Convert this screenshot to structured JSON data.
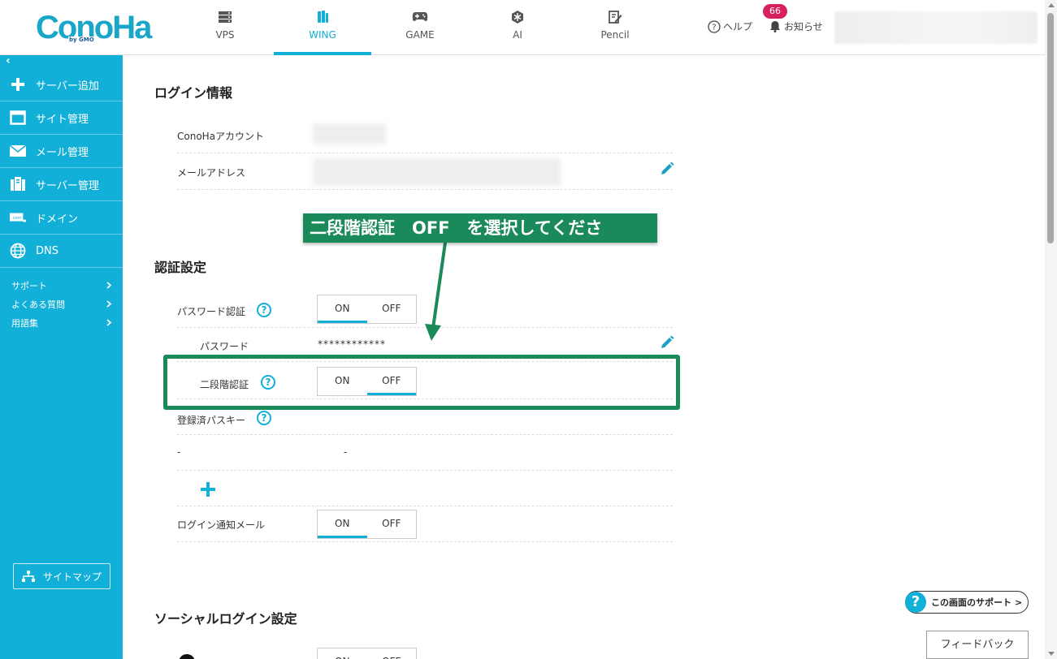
{
  "brand": {
    "logo": "ConoHa",
    "logo_sub": "by GMO",
    "accent": "#12b0d8",
    "annotation_color": "#1b8a5a"
  },
  "topnav": [
    {
      "label": "VPS",
      "icon": "server-icon",
      "active": false
    },
    {
      "label": "WING",
      "icon": "wing-icon",
      "active": true
    },
    {
      "label": "GAME",
      "icon": "gamepad-icon",
      "active": false
    },
    {
      "label": "AI",
      "icon": "ai-icon",
      "active": false
    },
    {
      "label": "Pencil",
      "icon": "pencil-icon",
      "active": false
    }
  ],
  "header": {
    "help": "ヘルプ",
    "notice": "お知らせ",
    "notice_count": "66"
  },
  "sidebar": {
    "collapse": "‹",
    "items": [
      {
        "label": "サーバー追加",
        "icon": "plus-icon"
      },
      {
        "label": "サイト管理",
        "icon": "window-icon"
      },
      {
        "label": "メール管理",
        "icon": "mail-icon"
      },
      {
        "label": "サーバー管理",
        "icon": "server-icon"
      },
      {
        "label": "ドメイン",
        "icon": "domain-icon"
      },
      {
        "label": "DNS",
        "icon": "globe-icon"
      }
    ],
    "subs": [
      {
        "label": "サポート"
      },
      {
        "label": "よくある質問"
      },
      {
        "label": "用語集"
      }
    ],
    "sitemap": "サイトマップ"
  },
  "login_info": {
    "title": "ログイン情報",
    "account_label": "ConoHaアカウント",
    "email_label": "メールアドレス"
  },
  "auth": {
    "title": "認証設定",
    "password_auth_label": "パスワード認証",
    "password_label": "パスワード",
    "password_value": "************",
    "two_factor_label": "二段階認証",
    "passkey_label": "登録済パスキー",
    "passkey_col1": "-",
    "passkey_col2": "-",
    "login_notice_label": "ログイン通知メール",
    "on": "ON",
    "off": "OFF"
  },
  "social": {
    "title": "ソーシャルログイン設定"
  },
  "annotation": {
    "callout": "二段階認証　OFF　を選択してくださ"
  },
  "support_button": "この画面のサポート",
  "support_q": "?",
  "support_arrow": ">",
  "feedback": "フィードバック"
}
